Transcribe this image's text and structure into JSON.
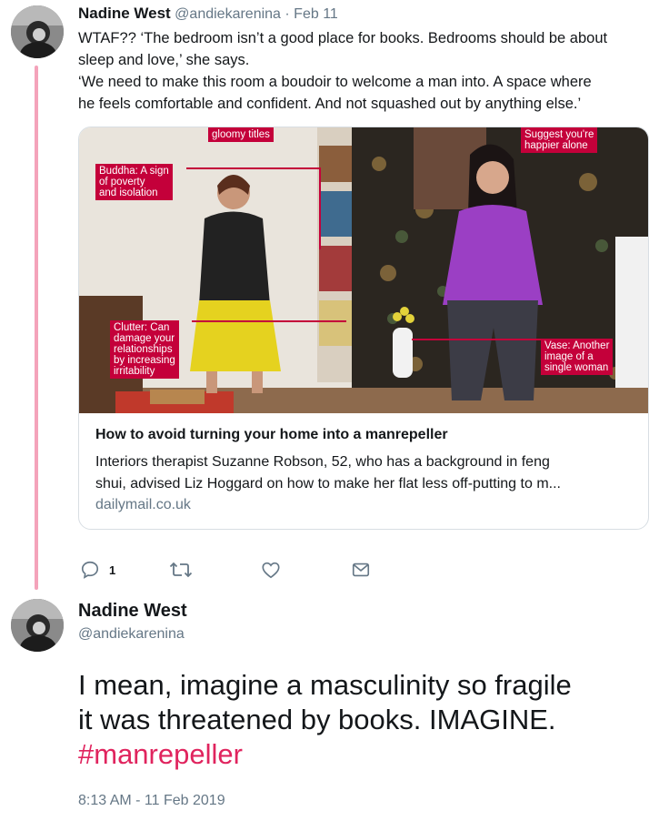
{
  "tweet1": {
    "name": "Nadine West",
    "handle": "@andiekarenina",
    "separator": "·",
    "date": "Feb 11",
    "text_lines": [
      "WTAF?? ‘The bedroom isn’t a good place for books. Bedrooms should be about",
      "sleep and love,’ she says.",
      "‘We need to make this room a boudoir to welcome a man into. A space where",
      "he feels comfortable and confident. And not squashed out by anything else.’"
    ],
    "card": {
      "title": "How to avoid turning your home into a manrepeller",
      "description_lines": [
        "Interiors therapist Suzanne Robson, 52, who has a background in feng",
        "shui, advised Liz Hoggard on how to make her flat less off-putting to m..."
      ],
      "domain": "dailymail.co.uk",
      "image_callouts": {
        "gloomy": "gloomy titles",
        "buddha": [
          "Buddha: A sign",
          "of poverty",
          "and isolation"
        ],
        "clutter": [
          "Clutter: Can",
          "damage your",
          "relationships",
          "by increasing",
          "irritability"
        ],
        "happier": [
          "Suggest you're",
          "happier alone"
        ],
        "vase": [
          "Vase: Another",
          "image of a",
          "single woman"
        ]
      }
    },
    "actions": {
      "reply_count": "1",
      "reply_icon": "reply-icon",
      "retweet_icon": "retweet-icon",
      "like_icon": "heart-icon",
      "dm_icon": "envelope-icon"
    }
  },
  "tweet2": {
    "name": "Nadine West",
    "handle": "@andiekarenina",
    "text_lines": [
      "I mean, imagine a masculinity so fragile",
      "it was threatened by books. IMAGINE."
    ],
    "hashtag": "#manrepeller",
    "timestamp": "8:13 AM - 11 Feb 2019"
  },
  "colors": {
    "thread_line": "#f4a3ba",
    "hashtag": "#e0245e",
    "secondary_text": "#657786",
    "callout": "#c4003a"
  }
}
